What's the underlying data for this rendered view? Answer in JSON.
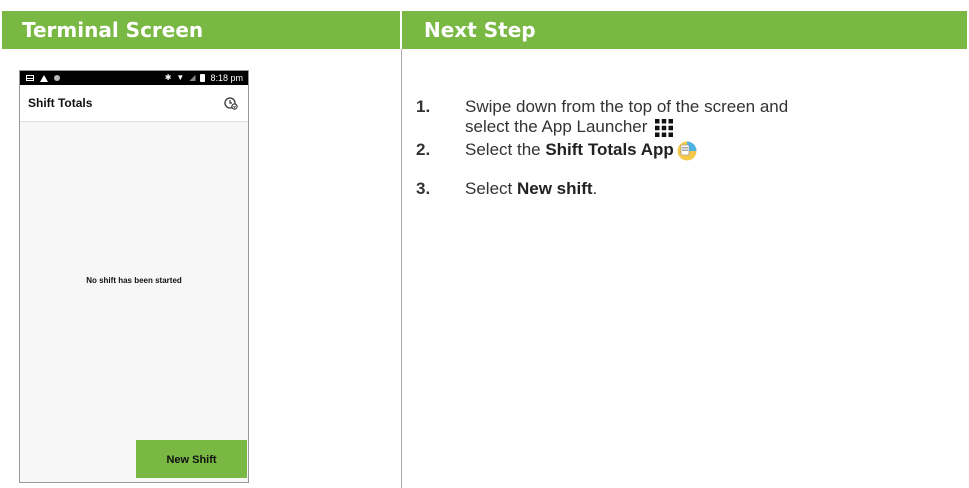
{
  "columns": {
    "left_title": "Terminal Screen",
    "right_title": "Next Step"
  },
  "terminal": {
    "status_time": "8:18 pm",
    "app_title": "Shift Totals",
    "empty_message": "No shift has been started",
    "new_shift_button": "New Shift"
  },
  "steps": [
    {
      "number": "1.",
      "line1": "Swipe down from the top of the screen and",
      "line2": "select the App Launcher",
      "icon": "app-launcher-grid-icon"
    },
    {
      "number": "2.",
      "prefix": "Select the ",
      "bold": "Shift Totals App",
      "icon": "shift-totals-app-icon"
    },
    {
      "number": "3.",
      "prefix": "Select ",
      "bold": "New shift",
      "suffix": "."
    }
  ],
  "colors": {
    "accent_green": "#7ab844",
    "text": "#333333"
  }
}
